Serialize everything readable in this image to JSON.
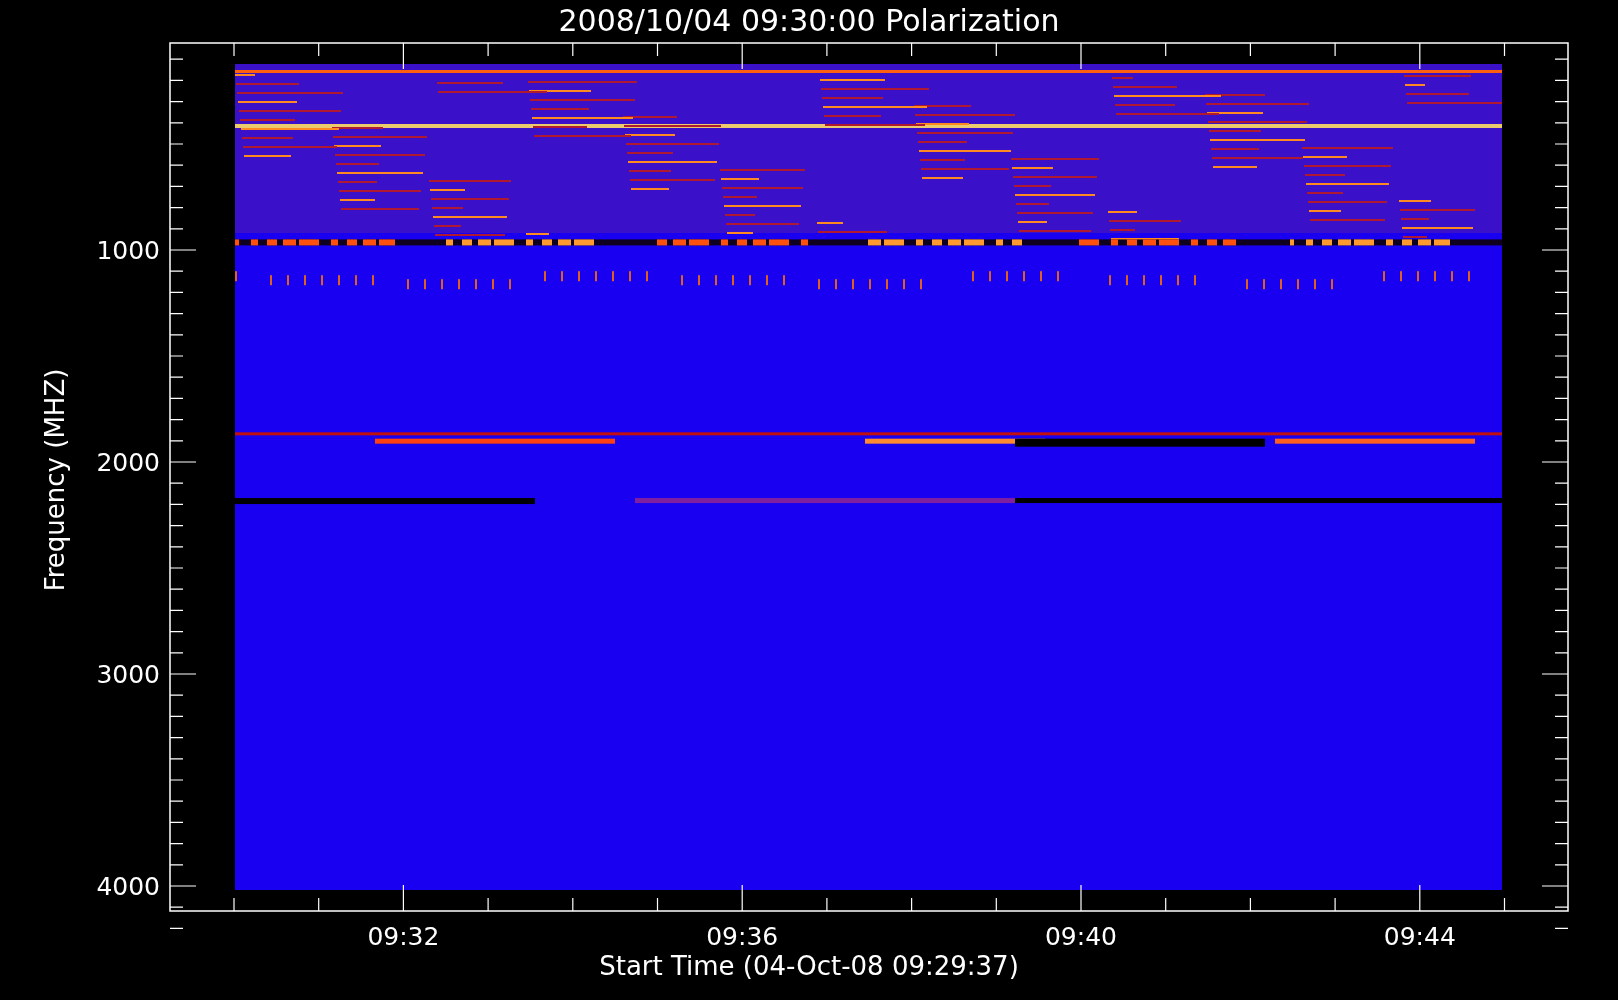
{
  "title": "2008/10/04 09:30:00 Polarization",
  "ylabel": "Frequency (MHZ)",
  "xlabel": "Start Time (04-Oct-08 09:29:37)",
  "yticks": [
    "1000",
    "2000",
    "3000",
    "4000"
  ],
  "xticks": [
    "09:32",
    "09:36",
    "09:40",
    "09:44"
  ]
}
